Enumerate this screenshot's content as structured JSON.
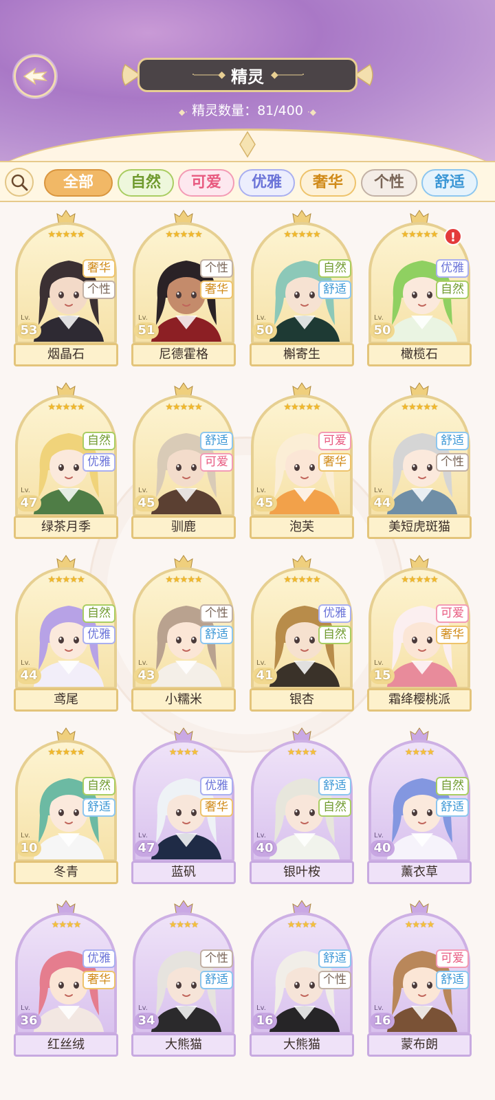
{
  "header": {
    "title": "精灵",
    "count_label": "精灵数量：",
    "count_value": "81/400"
  },
  "filters": [
    {
      "label": "全部",
      "color": "#ffffff",
      "bg": "#f1b866",
      "border": "#d9953e"
    },
    {
      "label": "自然",
      "color": "#6f9a2e",
      "bg": "#eef7dc",
      "border": "#a9cd62"
    },
    {
      "label": "可爱",
      "color": "#e85a80",
      "bg": "#fde8ef",
      "border": "#f39bb5"
    },
    {
      "label": "优雅",
      "color": "#6b74d8",
      "bg": "#eceefd",
      "border": "#a9aff0"
    },
    {
      "label": "奢华",
      "color": "#d08a18",
      "bg": "#fdf1d8",
      "border": "#eec36b"
    },
    {
      "label": "个性",
      "color": "#7a6658",
      "bg": "#f4ede7",
      "border": "#c2b1a5"
    },
    {
      "label": "舒适",
      "color": "#3a96d5",
      "bg": "#e6f3fc",
      "border": "#8cc6ef"
    }
  ],
  "level_prefix": "Lv.",
  "spirits": [
    {
      "name": "烟晶石",
      "level": "53",
      "stars": 5,
      "tags": [
        "奢华",
        "个性"
      ],
      "frame": "gold",
      "hair": "#3b3033",
      "skin": "#f3dac8",
      "outfit": "#2e2a33"
    },
    {
      "name": "尼德霍格",
      "level": "51",
      "stars": 5,
      "tags": [
        "个性",
        "奢华"
      ],
      "frame": "gold",
      "hair": "#2a2226",
      "skin": "#c48b6b",
      "outfit": "#8c1f24"
    },
    {
      "name": "槲寄生",
      "level": "50",
      "stars": 5,
      "tags": [
        "自然",
        "舒适"
      ],
      "frame": "gold",
      "hair": "#8cc8b8",
      "skin": "#f6e2d2",
      "outfit": "#1e3a34"
    },
    {
      "name": "橄榄石",
      "level": "50",
      "stars": 5,
      "tags": [
        "优雅",
        "自然"
      ],
      "frame": "gold",
      "hair": "#8fd061",
      "skin": "#fbe9dc",
      "outfit": "#eaf4e2",
      "alert": "!"
    },
    {
      "name": "绿茶月季",
      "level": "47",
      "stars": 5,
      "tags": [
        "自然",
        "优雅"
      ],
      "frame": "gold",
      "hair": "#f0d37a",
      "skin": "#fbe9dc",
      "outfit": "#4f7d46"
    },
    {
      "name": "驯鹿",
      "level": "45",
      "stars": 5,
      "tags": [
        "舒适",
        "可爱"
      ],
      "frame": "gold",
      "hair": "#d9cbb7",
      "skin": "#f3dccb",
      "outfit": "#5b4032"
    },
    {
      "name": "泡芙",
      "level": "45",
      "stars": 5,
      "tags": [
        "可爱",
        "奢华"
      ],
      "frame": "gold",
      "hair": "#fbeed6",
      "skin": "#fbe6d6",
      "outfit": "#f2a14a"
    },
    {
      "name": "美短虎斑猫",
      "level": "44",
      "stars": 5,
      "tags": [
        "舒适",
        "个性"
      ],
      "frame": "gold",
      "hair": "#d5d5d5",
      "skin": "#fbe9dc",
      "outfit": "#6f8ea6"
    },
    {
      "name": "鸢尾",
      "level": "44",
      "stars": 5,
      "tags": [
        "自然",
        "优雅"
      ],
      "frame": "gold",
      "hair": "#b7a2e6",
      "skin": "#fbe9dc",
      "outfit": "#f2eef9"
    },
    {
      "name": "小糯米",
      "level": "43",
      "stars": 5,
      "tags": [
        "个性",
        "舒适"
      ],
      "frame": "gold",
      "hair": "#b9a28f",
      "skin": "#fbe6d6",
      "outfit": "#f4efe8"
    },
    {
      "name": "银杏",
      "level": "41",
      "stars": 5,
      "tags": [
        "优雅",
        "自然"
      ],
      "frame": "gold",
      "hair": "#b88c4a",
      "skin": "#f6e1cf",
      "outfit": "#3a3229"
    },
    {
      "name": "霜绛樱桃派",
      "level": "15",
      "stars": 5,
      "tags": [
        "可爱",
        "奢华"
      ],
      "frame": "gold",
      "hair": "#fbeff0",
      "skin": "#fbe6d6",
      "outfit": "#e88b9b"
    },
    {
      "name": "冬青",
      "level": "10",
      "stars": 5,
      "tags": [
        "自然",
        "舒适"
      ],
      "frame": "gold",
      "hair": "#6cbaa3",
      "skin": "#fbe9dc",
      "outfit": "#f6f6f6"
    },
    {
      "name": "蓝矾",
      "level": "47",
      "stars": 4,
      "tags": [
        "优雅",
        "奢华"
      ],
      "frame": "purple",
      "hair": "#eef2f6",
      "skin": "#f8e6da",
      "outfit": "#1f2b46"
    },
    {
      "name": "银叶桉",
      "level": "40",
      "stars": 4,
      "tags": [
        "舒适",
        "自然"
      ],
      "frame": "purple",
      "hair": "#e7e6dc",
      "skin": "#f8e6da",
      "outfit": "#f1f3ec"
    },
    {
      "name": "薰衣草",
      "level": "40",
      "stars": 4,
      "tags": [
        "自然",
        "舒适"
      ],
      "frame": "purple",
      "hair": "#8397e0",
      "skin": "#fbe9dc",
      "outfit": "#f6f3fb"
    },
    {
      "name": "红丝绒",
      "level": "36",
      "stars": 4,
      "tags": [
        "优雅",
        "奢华"
      ],
      "frame": "purple",
      "hair": "#e57d8e",
      "skin": "#fbe6d6",
      "outfit": "#f2e7e2"
    },
    {
      "name": "大熊猫",
      "level": "34",
      "stars": 4,
      "tags": [
        "个性",
        "舒适"
      ],
      "frame": "purple",
      "hair": "#e6e3de",
      "skin": "#f6e4d8",
      "outfit": "#2b2a2c"
    },
    {
      "name": "大熊猫",
      "level": "16",
      "stars": 4,
      "tags": [
        "舒适",
        "个性"
      ],
      "frame": "purple",
      "hair": "#f1eee8",
      "skin": "#f6e4d8",
      "outfit": "#262527"
    },
    {
      "name": "蒙布朗",
      "level": "16",
      "stars": 4,
      "tags": [
        "可爱",
        "舒适"
      ],
      "frame": "purple",
      "hair": "#b9875a",
      "skin": "#fbe6d6",
      "outfit": "#7a5236"
    }
  ]
}
